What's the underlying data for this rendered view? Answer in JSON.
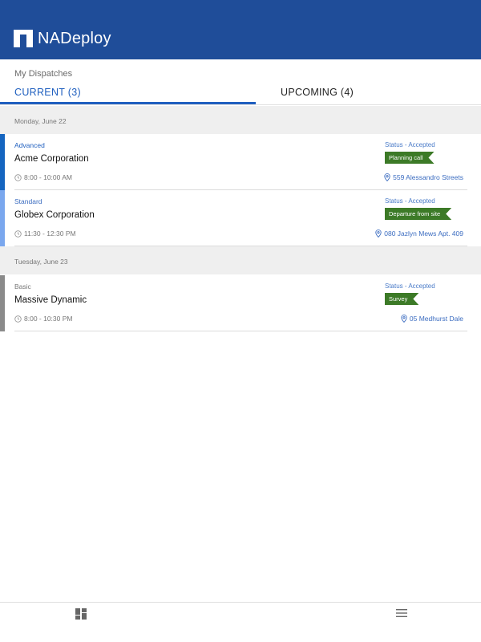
{
  "app": {
    "name": "NADeploy"
  },
  "page": {
    "title": "My Dispatches"
  },
  "tabs": [
    {
      "label": "CURRENT (3)",
      "active": true
    },
    {
      "label": "UPCOMING (4)",
      "active": false
    }
  ],
  "groups": [
    {
      "date": "Monday, June 22",
      "dispatches": [
        {
          "level": "Advanced",
          "level_color": "#1f5fbf",
          "bar_color": "#1565c0",
          "company": "Acme Corporation",
          "time": "8:00 - 10:00 AM",
          "status": "Status - Accepted",
          "tag": "Planning call",
          "address": "559 Alessandro Streets"
        },
        {
          "level": "Standard",
          "level_color": "#3b6cc0",
          "bar_color": "#7aa7ee",
          "company": "Globex Corporation",
          "time": "11:30 - 12:30 PM",
          "status": "Status - Accepted",
          "tag": "Departure from site",
          "address": "080 Jazlyn Mews Apt. 409"
        }
      ]
    },
    {
      "date": "Tuesday, June 23",
      "dispatches": [
        {
          "level": "Basic",
          "level_color": "#777777",
          "bar_color": "#8a8a8a",
          "company": "Massive Dynamic",
          "time": "8:00 - 10:30 PM",
          "status": "Status - Accepted",
          "tag": "Survey",
          "address": "05 Medhurst Dale"
        }
      ]
    }
  ],
  "bottom_nav": [
    {
      "icon": "dashboard-icon"
    },
    {
      "icon": "hamburger-menu-icon"
    }
  ],
  "colors": {
    "header": "#1f4d99",
    "accent": "#1f5fbf",
    "tag": "#3c7a27"
  }
}
